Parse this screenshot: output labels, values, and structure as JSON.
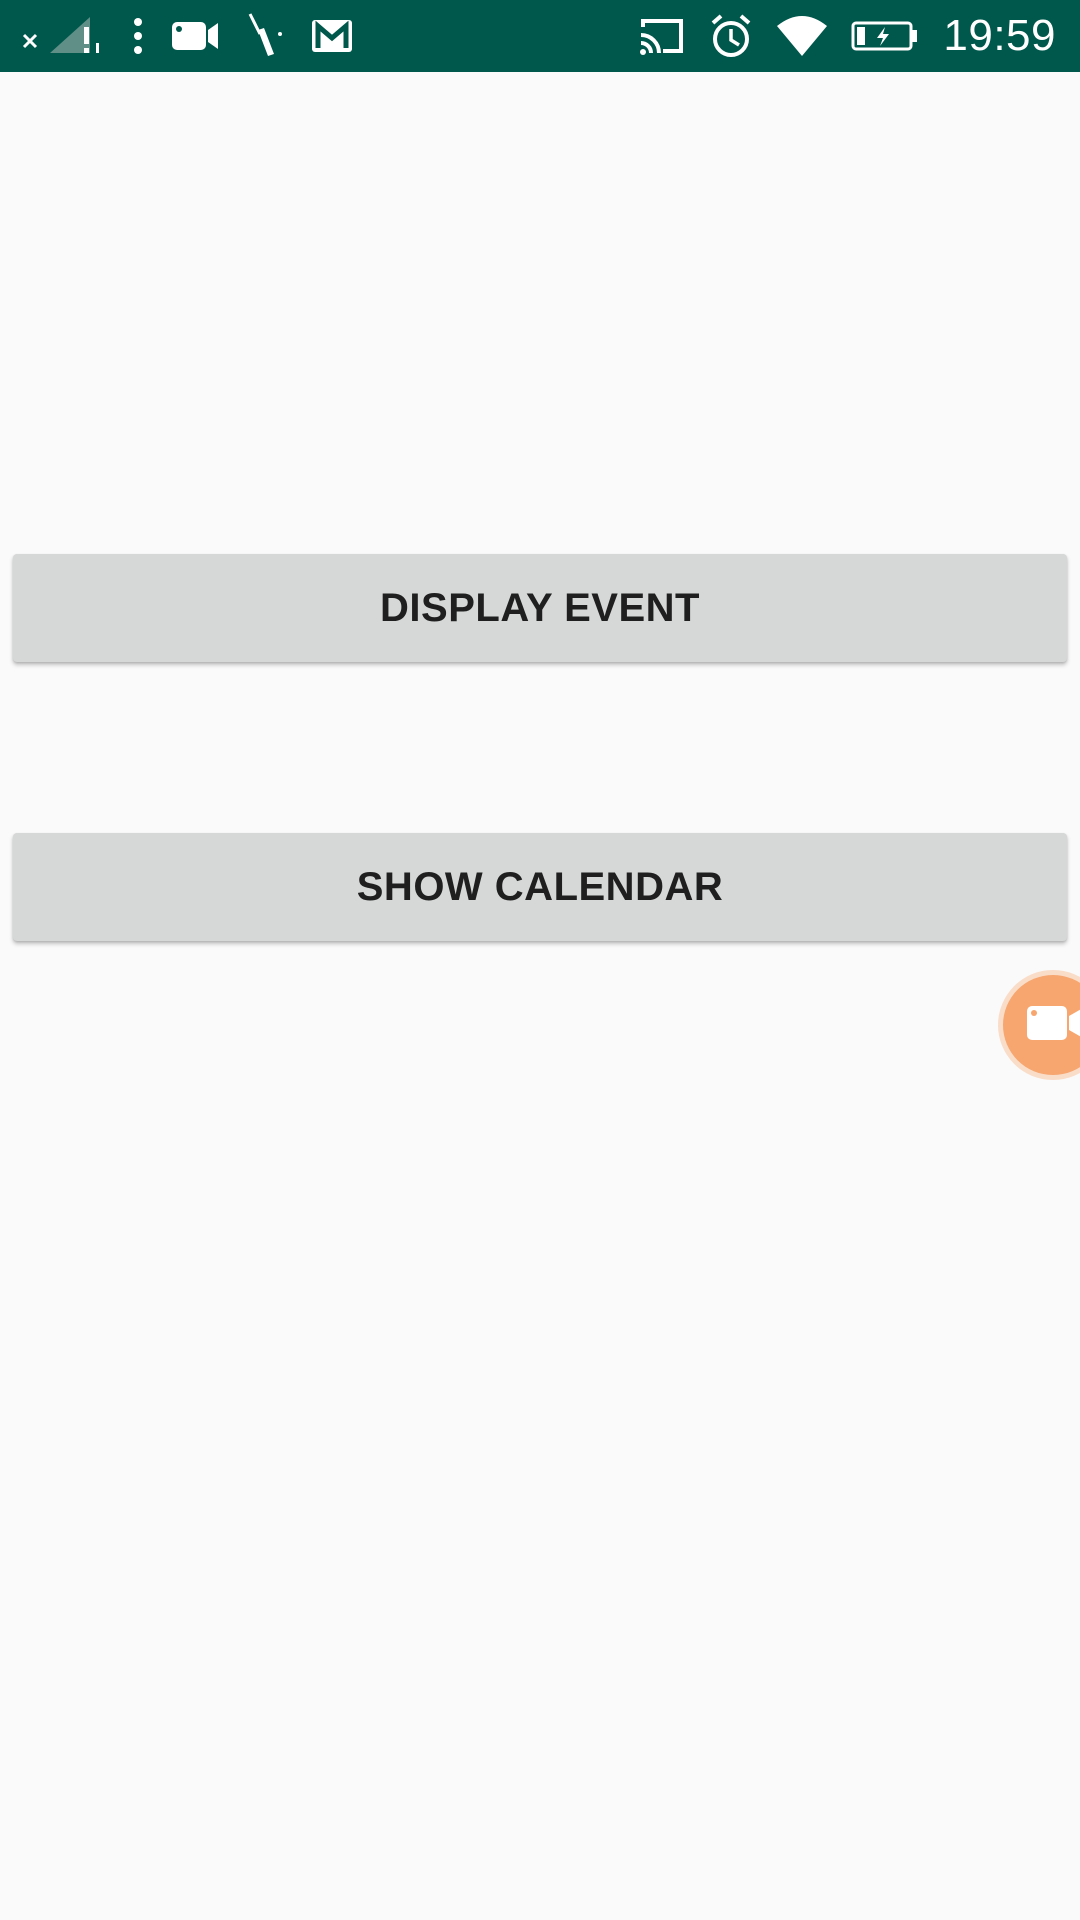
{
  "status_bar": {
    "time": "19:59",
    "background_color": "#00574b",
    "left_icons": [
      "signal-x-icon",
      "overflow-dots-icon",
      "video-camera-icon",
      "screwdriver-icon",
      "gmail-icon"
    ],
    "right_icons": [
      "cast-icon",
      "alarm-icon",
      "wifi-icon",
      "battery-charging-icon"
    ]
  },
  "main": {
    "buttons": [
      {
        "label": "DISPLAY EVENT"
      },
      {
        "label": "SHOW CALENDAR"
      }
    ],
    "button_color": "#d6d7d7"
  },
  "floating_button": {
    "icon": "video-camera-icon",
    "color": "#f6a66e"
  }
}
